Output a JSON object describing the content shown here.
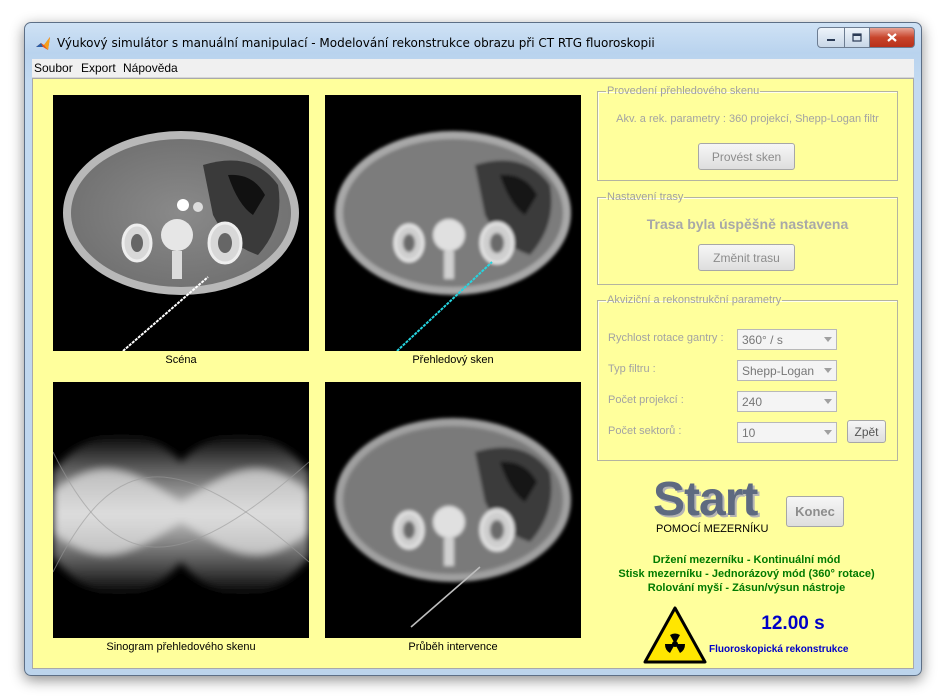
{
  "window": {
    "title": "Výukový simulátor s manuální manipulací - Modelování rekonstrukce obrazu při CT RTG fluoroskopii"
  },
  "menu": [
    "Soubor",
    "Export",
    "Nápověda"
  ],
  "images": {
    "scene_caption": "Scéna",
    "overview_caption": "Přehledový sken",
    "sinogram_caption": "Sinogram přehledového skenu",
    "intervention_caption": "Průběh intervence"
  },
  "scan_group": {
    "legend": "Provedení přehledového skenu",
    "info": "Akv. a rek. parametry : 360 projekcí, Shepp-Logan filtr",
    "button": "Provést sken"
  },
  "path_group": {
    "legend": "Nastavení trasy",
    "status": "Trasa byla úspěšně nastavena",
    "button": "Změnit trasu"
  },
  "params_group": {
    "legend": "Akviziční a rekonstrukční parametry",
    "fields": [
      {
        "label": "Rychlost rotace gantry :",
        "value": "360° / s"
      },
      {
        "label": "Typ filtru :",
        "value": "Shepp-Logan"
      },
      {
        "label": "Počet projekcí :",
        "value": "240"
      },
      {
        "label": "Počet sektorů :",
        "value": "10"
      }
    ],
    "back_button": "Zpět"
  },
  "start": {
    "big": "Start",
    "sub": "POMOCÍ MEZERNÍKU"
  },
  "end_button": "Konec",
  "instructions": [
    "Držení mezerníku - Kontinuální mód",
    "Stisk mezerníku - Jednorázový mód (360° rotace)",
    "Rolování myší - Zásun/výsun nástroje"
  ],
  "timer": "12.00 s",
  "mode_label": "Fluoroskopická rekonstrukce",
  "colors": {
    "panel_bg": "#ffff9c",
    "instruction_green": "#007a00",
    "timer_blue": "#0000c8"
  }
}
